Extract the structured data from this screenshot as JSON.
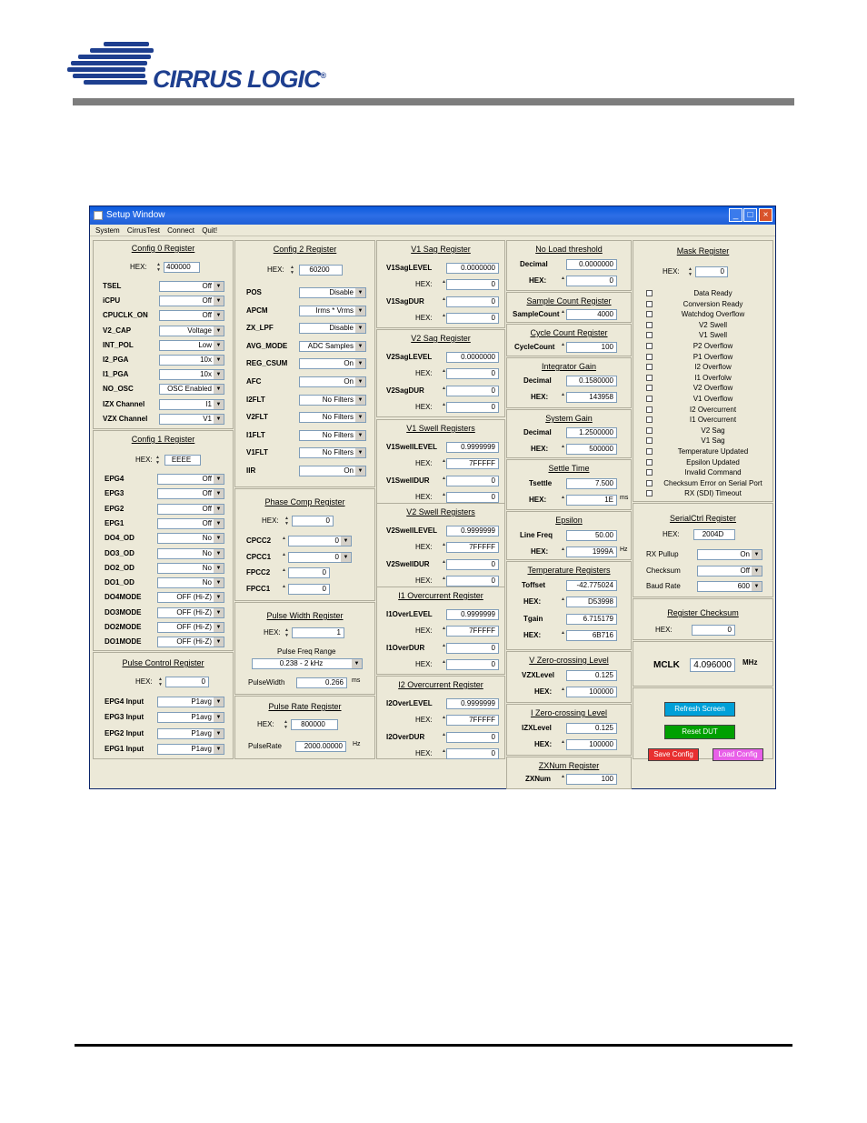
{
  "logo": {
    "name": "CIRRUS LOGIC",
    "mark": "®"
  },
  "window": {
    "title": "Setup Window",
    "menu": [
      "System",
      "CirrusTest",
      "Connect",
      "Quit!"
    ]
  },
  "config0": {
    "title": "Config 0 Register",
    "hex_label": "HEX:",
    "hex": "400000",
    "rows": [
      {
        "label": "TSEL",
        "value": "Off"
      },
      {
        "label": "iCPU",
        "value": "Off"
      },
      {
        "label": "CPUCLK_ON",
        "value": "Off"
      },
      {
        "label": "V2_CAP",
        "value": "Voltage"
      },
      {
        "label": "INT_POL",
        "value": "Low"
      },
      {
        "label": "I2_PGA",
        "value": "10x"
      },
      {
        "label": "I1_PGA",
        "value": "10x"
      },
      {
        "label": "NO_OSC",
        "value": "OSC Enabled"
      },
      {
        "label": "IZX Channel",
        "value": "I1"
      },
      {
        "label": "VZX Channel",
        "value": "V1"
      }
    ]
  },
  "config1": {
    "title": "Config 1 Register",
    "hex_label": "HEX:",
    "hex": "EEEE",
    "rows": [
      {
        "label": "EPG4",
        "value": "Off"
      },
      {
        "label": "EPG3",
        "value": "Off"
      },
      {
        "label": "EPG2",
        "value": "Off"
      },
      {
        "label": "EPG1",
        "value": "Off"
      },
      {
        "label": "DO4_OD",
        "value": "No"
      },
      {
        "label": "DO3_OD",
        "value": "No"
      },
      {
        "label": "DO2_OD",
        "value": "No"
      },
      {
        "label": "DO1_OD",
        "value": "No"
      },
      {
        "label": "DO4MODE",
        "value": "OFF (Hi-Z)"
      },
      {
        "label": "DO3MODE",
        "value": "OFF (Hi-Z)"
      },
      {
        "label": "DO2MODE",
        "value": "OFF (Hi-Z)"
      },
      {
        "label": "DO1MODE",
        "value": "OFF (Hi-Z)"
      }
    ]
  },
  "pulse_control": {
    "title": "Pulse Control Register",
    "hex_label": "HEX:",
    "hex": "0",
    "rows": [
      {
        "label": "EPG4 Input",
        "value": "P1avg"
      },
      {
        "label": "EPG3 Input",
        "value": "P1avg"
      },
      {
        "label": "EPG2 Input",
        "value": "P1avg"
      },
      {
        "label": "EPG1 Input",
        "value": "P1avg"
      }
    ]
  },
  "config2": {
    "title": "Config 2 Register",
    "hex_label": "HEX:",
    "hex": "60200",
    "rows": [
      {
        "label": "POS",
        "value": "Disable"
      },
      {
        "label": "APCM",
        "value": "Irms * Vrms"
      },
      {
        "label": "ZX_LPF",
        "value": "Disable"
      },
      {
        "label": "AVG_MODE",
        "value": "ADC Samples"
      },
      {
        "label": "REG_CSUM",
        "value": "On"
      },
      {
        "label": "AFC",
        "value": "On"
      },
      {
        "label": "I2FLT",
        "value": "No Filters"
      },
      {
        "label": "V2FLT",
        "value": "No Filters"
      },
      {
        "label": "I1FLT",
        "value": "No Filters"
      },
      {
        "label": "V1FLT",
        "value": "No Filters"
      },
      {
        "label": "IIR",
        "value": "On"
      }
    ]
  },
  "phase_comp": {
    "title": "Phase Comp Register",
    "hex_label": "HEX:",
    "hex": "0",
    "rows": [
      {
        "label": "CPCC2",
        "value": "0"
      },
      {
        "label": "CPCC1",
        "value": "0"
      },
      {
        "label": "FPCC2",
        "value": "0"
      },
      {
        "label": "FPCC1",
        "value": "0"
      }
    ]
  },
  "pulse_width": {
    "title": "Pulse Width Register",
    "hex_label": "HEX:",
    "hex": "1",
    "freq_range_label": "Pulse Freq Range",
    "freq_range": "0.238 - 2 kHz",
    "width_label": "PulseWidth",
    "width": "0.266",
    "width_unit": "ms"
  },
  "pulse_rate": {
    "title": "Pulse Rate Register",
    "hex_label": "HEX:",
    "hex": "800000",
    "rate_label": "PulseRate",
    "rate": "2000.00000",
    "rate_unit": "Hz"
  },
  "v1sag": {
    "title": "V1 Sag Register",
    "level_label": "V1SagLEVEL",
    "level": "0.0000000",
    "hex_label": "HEX:",
    "level_hex": "0",
    "dur_label": "V1SagDUR",
    "dur": "0",
    "dur_hex": "0"
  },
  "v2sag": {
    "title": "V2 Sag Register",
    "level_label": "V2SagLEVEL",
    "level": "0.0000000",
    "hex_label": "HEX:",
    "level_hex": "0",
    "dur_label": "V2SagDUR",
    "dur": "0",
    "dur_hex": "0"
  },
  "v1swell": {
    "title": "V1 Swell Registers",
    "level_label": "V1SwellLEVEL",
    "level": "0.9999999",
    "hex_label": "HEX:",
    "level_hex": "7FFFFF",
    "dur_label": "V1SwellDUR",
    "dur": "0",
    "dur_hex": "0"
  },
  "v2swell": {
    "title": "V2 Swell Registers",
    "level_label": "V2SwellLEVEL",
    "level": "0.9999999",
    "hex_label": "HEX:",
    "level_hex": "7FFFFF",
    "dur_label": "V2SwellDUR",
    "dur": "0",
    "dur_hex": "0"
  },
  "i1over": {
    "title": "I1 Overcurrent Register",
    "level_label": "I1OverLEVEL",
    "level": "0.9999999",
    "hex_label": "HEX:",
    "level_hex": "7FFFFF",
    "dur_label": "I1OverDUR",
    "dur": "0",
    "dur_hex": "0"
  },
  "i2over": {
    "title": "I2 Overcurrent Register",
    "level_label": "I2OverLEVEL",
    "level": "0.9999999",
    "hex_label": "HEX:",
    "level_hex": "7FFFFF",
    "dur_label": "I2OverDUR",
    "dur": "0",
    "dur_hex": "0"
  },
  "noload": {
    "title": "No Load threshold",
    "dec_label": "Decimal",
    "dec": "0.0000000",
    "hex_label": "HEX:",
    "hex": "0"
  },
  "sample_count": {
    "title": "Sample Count Register",
    "label": "SampleCount",
    "value": "4000"
  },
  "cycle_count": {
    "title": "Cycle Count Register",
    "label": "CycleCount",
    "value": "100"
  },
  "integrator": {
    "title": "Integrator Gain",
    "dec_label": "Decimal",
    "dec": "0.1580000",
    "hex_label": "HEX:",
    "hex": "143958"
  },
  "system_gain": {
    "title": "System Gain",
    "dec_label": "Decimal",
    "dec": "1.2500000",
    "hex_label": "HEX:",
    "hex": "500000"
  },
  "settle": {
    "title": "Settle Time",
    "label": "Tsettle",
    "value": "7.500",
    "hex_label": "HEX:",
    "hex": "1E",
    "unit": "ms"
  },
  "epsilon": {
    "title": "Epsilon",
    "label": "Line Freq",
    "value": "50.00",
    "hex_label": "HEX:",
    "hex": "1999A",
    "unit": "Hz"
  },
  "temperature": {
    "title": "Temperature Registers",
    "toffset_label": "Toffset",
    "toffset": "-42.775024",
    "hex_label": "HEX:",
    "toffset_hex": "D53998",
    "tgain_label": "Tgain",
    "tgain": "6.715179",
    "tgain_hex": "6B716"
  },
  "vzc": {
    "title": "V Zero-crossing Level",
    "label": "VZXLevel",
    "value": "0.125",
    "hex_label": "HEX:",
    "hex": "100000"
  },
  "izc": {
    "title": "I Zero-crossing Level",
    "label": "IZXLevel",
    "value": "0.125",
    "hex_label": "HEX:",
    "hex": "100000"
  },
  "zxnum": {
    "title": "ZXNum Register",
    "label": "ZXNum",
    "value": "100"
  },
  "mask": {
    "title": "Mask Register",
    "hex_label": "HEX:",
    "hex": "0",
    "items": [
      "Data Ready",
      "Conversion Ready",
      "Watchdog Overflow",
      "V2 Swell",
      "V1 Swell",
      "P2 Overflow",
      "P1 Overflow",
      "I2 Overflow",
      "I1 Overfolw",
      "V2 Overflow",
      "V1 Overflow",
      "I2 Overcurrent",
      "I1 Overcurrent",
      "V2 Sag",
      "V1 Sag",
      "Temperature Updated",
      "Epsilon Updated",
      "Invalid Command",
      "Checksum Error on Serial Port",
      "RX (SDI) Timeout"
    ]
  },
  "serialctrl": {
    "title": "SerialCtrl Register",
    "hex_label": "HEX:",
    "hex": "2004D",
    "rows": [
      {
        "label": "RX Pullup",
        "value": "On"
      },
      {
        "label": "Checksum",
        "value": "Off"
      },
      {
        "label": "Baud Rate",
        "value": "600"
      }
    ]
  },
  "checksum": {
    "title": "Register Checksum",
    "hex_label": "HEX:",
    "hex": "0"
  },
  "mclk": {
    "label": "MCLK",
    "value": "4.096000",
    "unit": "MHz"
  },
  "buttons": {
    "refresh": {
      "label": "Refresh Screen",
      "color": "#00a0d8"
    },
    "reset": {
      "label": "Reset DUT",
      "color": "#00a000"
    },
    "save": {
      "label": "Save Config",
      "color": "#e83030"
    },
    "load": {
      "label": "Load Config",
      "color": "#e860e8"
    }
  }
}
